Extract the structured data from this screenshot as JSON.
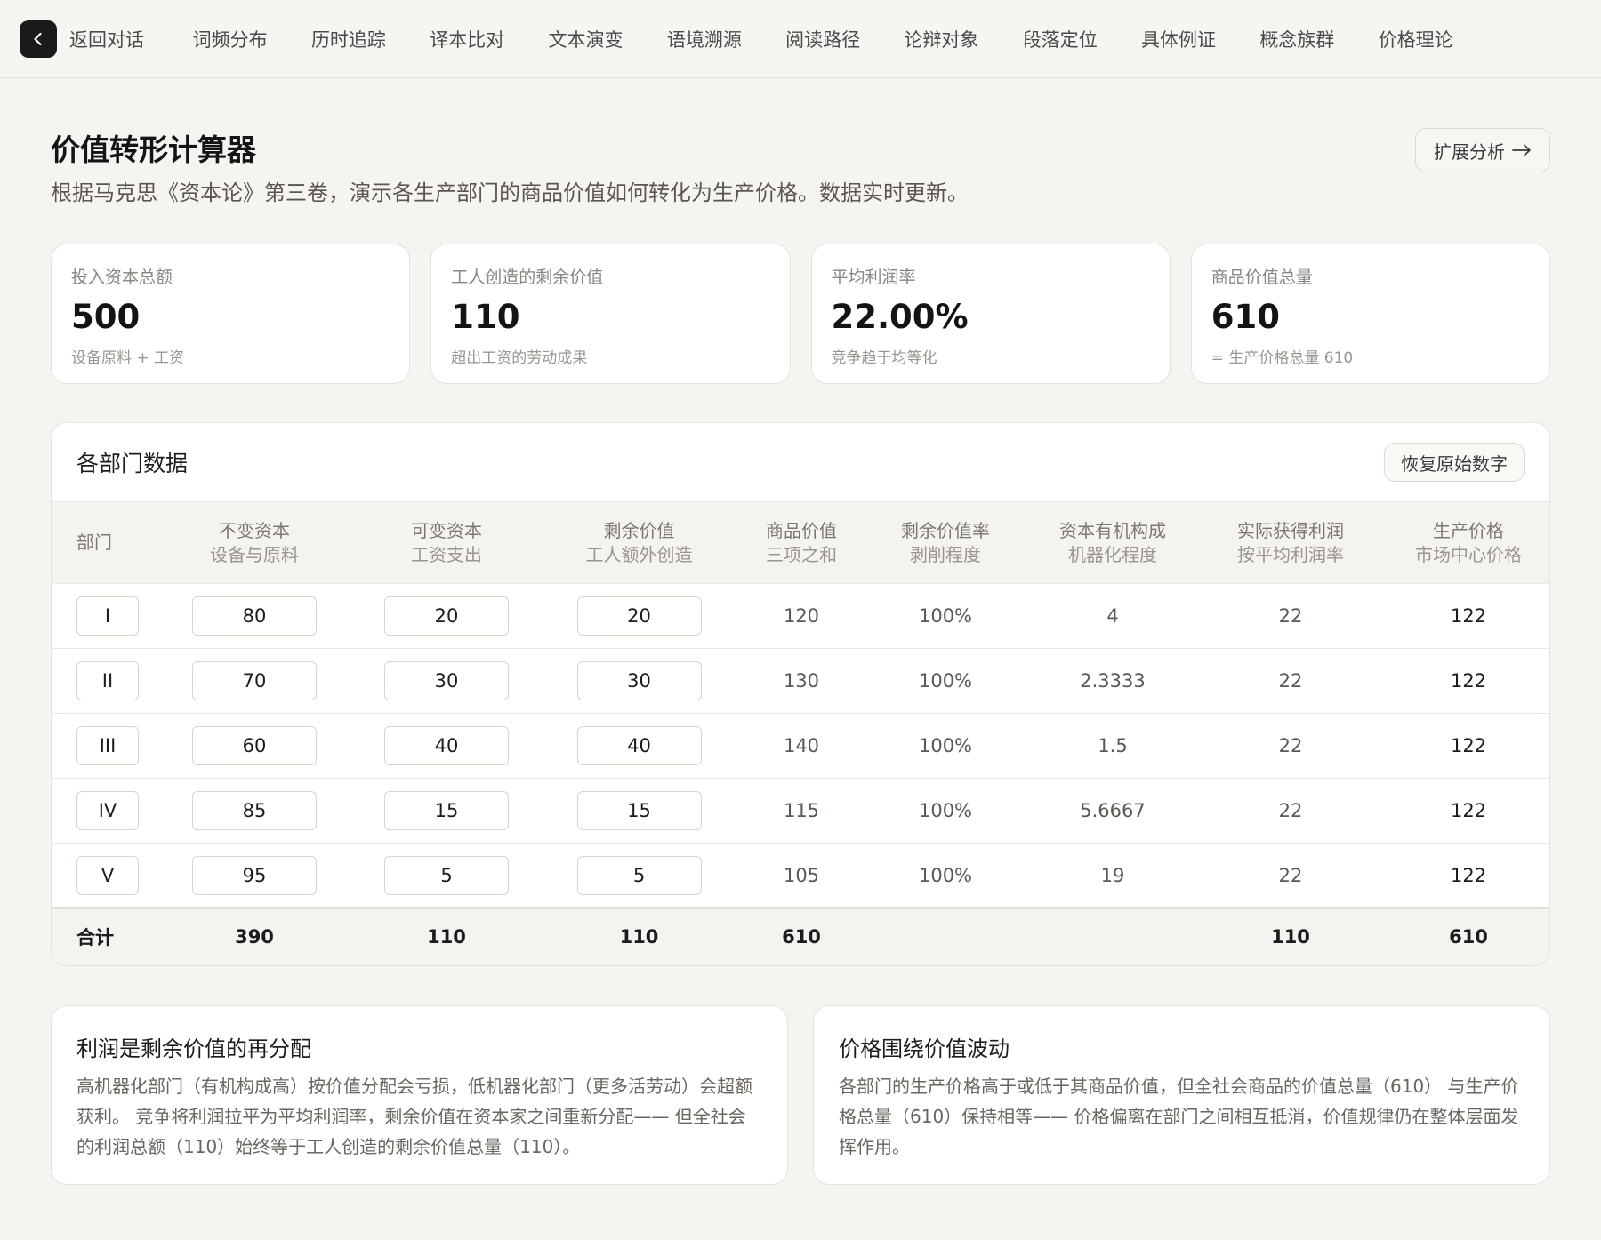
{
  "nav": {
    "back_label": "返回对话",
    "items": [
      "词频分布",
      "历时追踪",
      "译本比对",
      "文本演变",
      "语境溯源",
      "阅读路径",
      "论辩对象",
      "段落定位",
      "具体例证",
      "概念族群",
      "价格理论"
    ]
  },
  "header": {
    "title": "价值转形计算器",
    "subtitle": "根据马克思《资本论》第三卷，演示各生产部门的商品价值如何转化为生产价格。数据实时更新。",
    "extend_label": "扩展分析"
  },
  "stats": [
    {
      "label": "投入资本总额",
      "value": "500",
      "note": "设备原料 + 工资"
    },
    {
      "label": "工人创造的剩余价值",
      "value": "110",
      "note": "超出工资的劳动成果"
    },
    {
      "label": "平均利润率",
      "value": "22.00%",
      "note": "竞争趋于均等化"
    },
    {
      "label": "商品价值总量",
      "value": "610",
      "note": "= 生产价格总量 610"
    }
  ],
  "table": {
    "title": "各部门数据",
    "reset_label": "恢复原始数字",
    "headers": [
      {
        "main": "部门",
        "sub": ""
      },
      {
        "main": "不变资本",
        "sub": "设备与原料"
      },
      {
        "main": "可变资本",
        "sub": "工资支出"
      },
      {
        "main": "剩余价值",
        "sub": "工人额外创造"
      },
      {
        "main": "商品价值",
        "sub": "三项之和"
      },
      {
        "main": "剩余价值率",
        "sub": "剥削程度"
      },
      {
        "main": "资本有机构成",
        "sub": "机器化程度"
      },
      {
        "main": "实际获得利润",
        "sub": "按平均利润率"
      },
      {
        "main": "生产价格",
        "sub": "市场中心价格"
      }
    ],
    "rows": [
      {
        "dept": "I",
        "c": "80",
        "v": "20",
        "s": "20",
        "value": "120",
        "rate": "100%",
        "occ": "4",
        "profit": "22",
        "price": "122"
      },
      {
        "dept": "II",
        "c": "70",
        "v": "30",
        "s": "30",
        "value": "130",
        "rate": "100%",
        "occ": "2.3333",
        "profit": "22",
        "price": "122"
      },
      {
        "dept": "III",
        "c": "60",
        "v": "40",
        "s": "40",
        "value": "140",
        "rate": "100%",
        "occ": "1.5",
        "profit": "22",
        "price": "122"
      },
      {
        "dept": "IV",
        "c": "85",
        "v": "15",
        "s": "15",
        "value": "115",
        "rate": "100%",
        "occ": "5.6667",
        "profit": "22",
        "price": "122"
      },
      {
        "dept": "V",
        "c": "95",
        "v": "5",
        "s": "5",
        "value": "105",
        "rate": "100%",
        "occ": "19",
        "profit": "22",
        "price": "122"
      }
    ],
    "totals": {
      "label": "合计",
      "c": "390",
      "v": "110",
      "s": "110",
      "value": "610",
      "rate": "",
      "occ": "",
      "profit": "110",
      "price": "610"
    }
  },
  "notes": [
    {
      "title": "利润是剩余价值的再分配",
      "body": "高机器化部门（有机构成高）按价值分配会亏损，低机器化部门（更多活劳动）会超额获利。 竞争将利润拉平为平均利润率，剩余价值在资本家之间重新分配—— 但全社会的利润总额（110）始终等于工人创造的剩余价值总量（110）。"
    },
    {
      "title": "价格围绕价值波动",
      "body": "各部门的生产价格高于或低于其商品价值，但全社会商品的价值总量（610） 与生产价格总量（610）保持相等—— 价格偏离在部门之间相互抵消，价值规律仍在整体层面发挥作用。"
    }
  ]
}
